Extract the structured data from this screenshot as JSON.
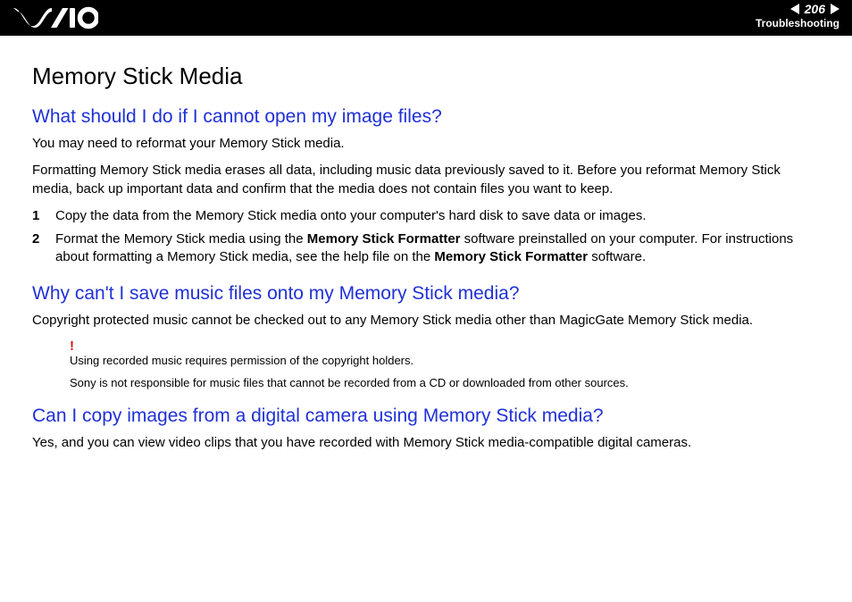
{
  "header": {
    "page_number": "206",
    "section": "Troubleshooting",
    "logo_alt": "VAIO"
  },
  "title": "Memory Stick Media",
  "q1": {
    "heading": "What should I do if I cannot open my image files?",
    "p1": "You may need to reformat your Memory Stick media.",
    "p2": "Formatting Memory Stick media erases all data, including music data previously saved to it. Before you reformat Memory Stick media, back up important data and confirm that the media does not contain files you want to keep.",
    "step1_num": "1",
    "step1": "Copy the data from the Memory Stick media onto your computer's hard disk to save data or images.",
    "step2_num": "2",
    "step2_a": "Format the Memory Stick media using the ",
    "step2_b": "Memory Stick Formatter",
    "step2_c": " software preinstalled on your computer. For instructions about formatting a Memory Stick media, see the help file on the ",
    "step2_d": "Memory Stick Formatter",
    "step2_e": " software."
  },
  "q2": {
    "heading": "Why can't I save music files onto my Memory Stick media?",
    "p1": "Copyright protected music cannot be checked out to any Memory Stick media other than MagicGate Memory Stick media.",
    "bang": "!",
    "note1": "Using recorded music requires permission of the copyright holders.",
    "note2": "Sony is not responsible for music files that cannot be recorded from a CD or downloaded from other sources."
  },
  "q3": {
    "heading": "Can I copy images from a digital camera using Memory Stick media?",
    "p1": "Yes, and you can view video clips that you have recorded with Memory Stick media-compatible digital cameras."
  }
}
